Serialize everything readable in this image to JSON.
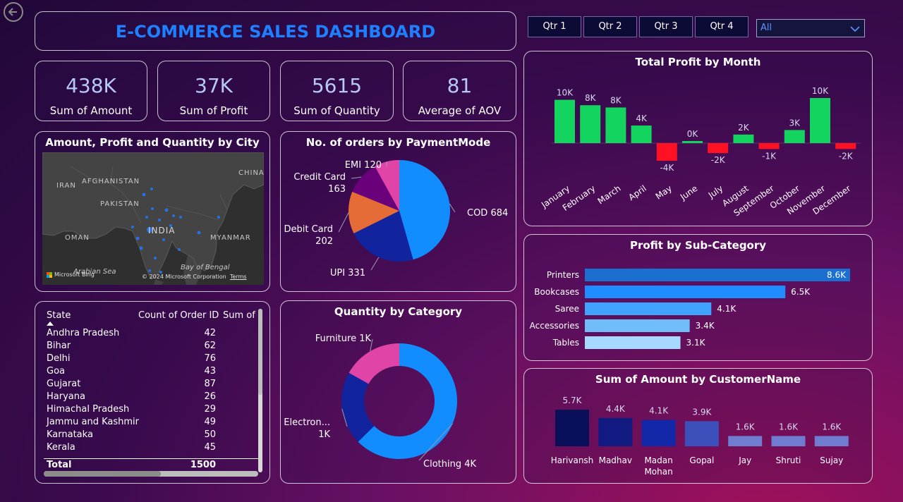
{
  "dashboard": {
    "title": "E-COMMERCE SALES DASHBOARD",
    "quarter_buttons": [
      "Qtr 1",
      "Qtr 2",
      "Qtr 3",
      "Qtr 4"
    ],
    "filter_selected": "All"
  },
  "kpis": [
    {
      "value": "438K",
      "label": "Sum of Amount"
    },
    {
      "value": "37K",
      "label": "Sum of Profit"
    },
    {
      "value": "5615",
      "label": "Sum of Quantity"
    },
    {
      "value": "81",
      "label": "Average of AOV"
    }
  ],
  "map": {
    "title": "Amount, Profit and Quantity by City",
    "labels": [
      "IRAN",
      "AFGHANISTAN",
      "PAKISTAN",
      "INDIA",
      "OMAN",
      "MYANMAR",
      "CHINA",
      "Arabian Sea",
      "Bay of Bengal"
    ],
    "attribution": "© 2024 Microsoft Corporation",
    "terms": "Terms",
    "provider": "Microsoft Bing"
  },
  "table": {
    "headers": [
      "State",
      "Count of Order ID",
      "Sum of C"
    ],
    "rows": [
      {
        "state": "Andhra Pradesh",
        "count": "42"
      },
      {
        "state": "Bihar",
        "count": "62"
      },
      {
        "state": "Delhi",
        "count": "76"
      },
      {
        "state": "Goa",
        "count": "43"
      },
      {
        "state": "Gujarat",
        "count": "87"
      },
      {
        "state": "Haryana",
        "count": "26"
      },
      {
        "state": "Himachal Pradesh",
        "count": "29"
      },
      {
        "state": "Jammu and Kashmir",
        "count": "49"
      },
      {
        "state": "Karnataka",
        "count": "50"
      },
      {
        "state": "Kerala",
        "count": "45"
      }
    ],
    "total_label": "Total",
    "total_value": "1500"
  },
  "chart_data": [
    {
      "id": "payment",
      "type": "pie",
      "title": "No. of orders by PaymentMode",
      "categories": [
        "COD",
        "UPI",
        "Debit Card",
        "Credit Card",
        "EMI"
      ],
      "values": [
        684,
        331,
        202,
        163,
        120
      ],
      "labels": [
        "COD 684",
        "UPI 331",
        "Debit Card 202",
        "Credit Card 163",
        "EMI 120"
      ],
      "colors": [
        "#118dff",
        "#12239e",
        "#e66c37",
        "#6b007b",
        "#e044a7"
      ]
    },
    {
      "id": "category",
      "type": "pie",
      "title": "Quantity by Category",
      "categories": [
        "Clothing",
        "Electronics",
        "Furniture"
      ],
      "values": [
        3516,
        1154,
        945
      ],
      "labels": [
        "Clothing 4K",
        "Electron... 1K",
        "Furniture 1K"
      ],
      "colors": [
        "#118dff",
        "#12239e",
        "#e044a7"
      ]
    },
    {
      "id": "monthly_profit",
      "type": "bar",
      "title": "Total Profit by Month",
      "categories": [
        "January",
        "February",
        "March",
        "April",
        "May",
        "June",
        "July",
        "August",
        "September",
        "October",
        "November",
        "December"
      ],
      "values": [
        9600,
        8400,
        7900,
        3900,
        -3900,
        200,
        -2200,
        1900,
        -1300,
        2900,
        10000,
        -1300
      ],
      "data_labels": [
        "10K",
        "8K",
        "8K",
        "4K",
        "-4K",
        "0K",
        "-2K",
        "2K",
        "-1K",
        "3K",
        "10K",
        "-2K"
      ],
      "positive_color": "#14d460",
      "negative_color": "#ff1124"
    },
    {
      "id": "subcategory_profit",
      "type": "bar",
      "title": "Profit by Sub-Category",
      "categories": [
        "Printers",
        "Bookcases",
        "Saree",
        "Accessories",
        "Tables"
      ],
      "values": [
        8600,
        6500,
        4100,
        3400,
        3100
      ],
      "data_labels": [
        "8.6K",
        "6.5K",
        "4.1K",
        "3.4K",
        "3.1K"
      ],
      "colors": [
        "#1a6fd0",
        "#1f8cff",
        "#3fa3ff",
        "#70bdfa",
        "#a7d8ff"
      ]
    },
    {
      "id": "customer_amount",
      "type": "bar",
      "title": "Sum of Amount by CustomerName",
      "categories": [
        "Harivansh",
        "Madhav",
        "Madan Mohan",
        "Gopal",
        "Jay",
        "Shruti",
        "Sujay"
      ],
      "values": [
        5700,
        4400,
        4100,
        3900,
        1600,
        1600,
        1600
      ],
      "data_labels": [
        "5.7K",
        "4.4K",
        "4.1K",
        "3.9K",
        "1.6K",
        "1.6K",
        "1.6K"
      ],
      "colors": [
        "#0a0f5a",
        "#101a80",
        "#1328a8",
        "#3c4fba",
        "#6f7cd0",
        "#6f7cd0",
        "#6f7cd0"
      ]
    }
  ]
}
